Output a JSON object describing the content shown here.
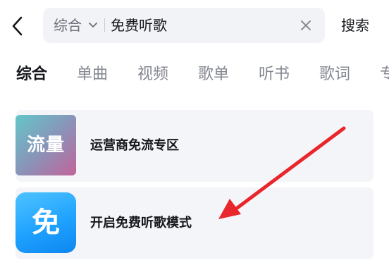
{
  "header": {
    "back_icon": "chevron-left-icon",
    "search": {
      "scope_label": "综合",
      "scope_icon": "chevron-down-icon",
      "query": "免费听歌",
      "clear_icon": "close-icon"
    },
    "search_button_label": "搜索"
  },
  "tabs": [
    {
      "label": "综合",
      "active": true
    },
    {
      "label": "单曲",
      "active": false
    },
    {
      "label": "视频",
      "active": false
    },
    {
      "label": "歌单",
      "active": false
    },
    {
      "label": "听书",
      "active": false
    },
    {
      "label": "歌词",
      "active": false
    },
    {
      "label": "专",
      "active": false
    }
  ],
  "results": [
    {
      "icon_text": "流量",
      "title": "运营商免流专区"
    },
    {
      "icon_text": "免",
      "title": "开启免费听歌模式"
    }
  ],
  "annotation": {
    "color": "#e8262b"
  }
}
